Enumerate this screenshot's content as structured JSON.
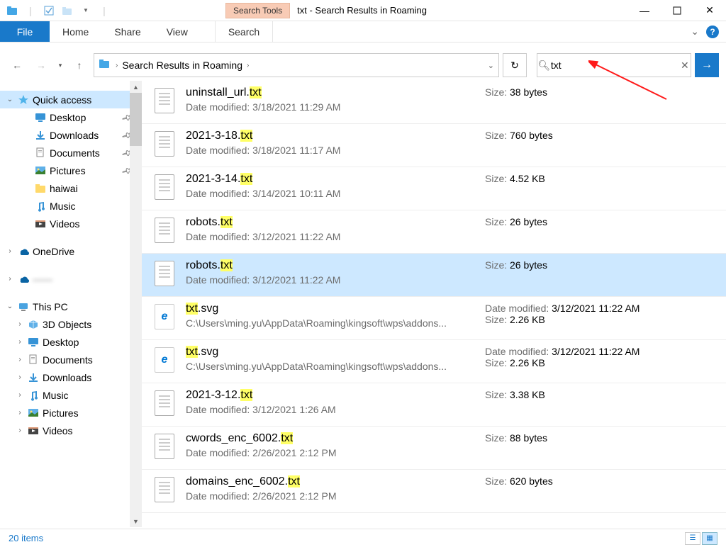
{
  "titlebar": {
    "search_tools": "Search Tools",
    "title": "txt - Search Results in Roaming"
  },
  "ribbon": {
    "file": "File",
    "tabs": [
      "Home",
      "Share",
      "View",
      "Search"
    ]
  },
  "breadcrumb": {
    "text": "Search Results in Roaming"
  },
  "search": {
    "value": "txt"
  },
  "sidebar": {
    "quick_access": "Quick access",
    "qa_items": [
      {
        "label": "Desktop",
        "pinned": true,
        "icon": "desktop"
      },
      {
        "label": "Downloads",
        "pinned": true,
        "icon": "downloads"
      },
      {
        "label": "Documents",
        "pinned": true,
        "icon": "documents"
      },
      {
        "label": "Pictures",
        "pinned": true,
        "icon": "pictures"
      },
      {
        "label": "haiwai",
        "pinned": false,
        "icon": "folder"
      },
      {
        "label": "Music",
        "pinned": false,
        "icon": "music"
      },
      {
        "label": "Videos",
        "pinned": false,
        "icon": "videos"
      }
    ],
    "onedrive": "OneDrive",
    "cloud2": "——",
    "this_pc": "This PC",
    "pc_items": [
      {
        "label": "3D Objects",
        "icon": "3d"
      },
      {
        "label": "Desktop",
        "icon": "desktop"
      },
      {
        "label": "Documents",
        "icon": "documents"
      },
      {
        "label": "Downloads",
        "icon": "downloads"
      },
      {
        "label": "Music",
        "icon": "music"
      },
      {
        "label": "Pictures",
        "icon": "pictures"
      },
      {
        "label": "Videos",
        "icon": "videos"
      }
    ]
  },
  "labels": {
    "size": "Size:",
    "date_modified": "Date modified:"
  },
  "items": [
    {
      "name_pre": "uninstall_url.",
      "hl": "txt",
      "name_post": "",
      "line2_kind": "date",
      "line2": "3/18/2021 11:29 AM",
      "r1_kind": "size",
      "r1": "38 bytes",
      "r2_kind": "",
      "r2": "",
      "icon": "doc",
      "sel": false
    },
    {
      "name_pre": "2021-3-18.",
      "hl": "txt",
      "name_post": "",
      "line2_kind": "date",
      "line2": "3/18/2021 11:17 AM",
      "r1_kind": "size",
      "r1": "760 bytes",
      "r2_kind": "",
      "r2": "",
      "icon": "doc",
      "sel": false
    },
    {
      "name_pre": "2021-3-14.",
      "hl": "txt",
      "name_post": "",
      "line2_kind": "date",
      "line2": "3/14/2021 10:11 AM",
      "r1_kind": "size",
      "r1": "4.52 KB",
      "r2_kind": "",
      "r2": "",
      "icon": "doc",
      "sel": false
    },
    {
      "name_pre": "robots.",
      "hl": "txt",
      "name_post": "",
      "line2_kind": "date",
      "line2": "3/12/2021 11:22 AM",
      "r1_kind": "size",
      "r1": "26 bytes",
      "r2_kind": "",
      "r2": "",
      "icon": "doc",
      "sel": false
    },
    {
      "name_pre": "robots.",
      "hl": "txt",
      "name_post": "",
      "line2_kind": "date",
      "line2": "3/12/2021 11:22 AM",
      "r1_kind": "size",
      "r1": "26 bytes",
      "r2_kind": "",
      "r2": "",
      "icon": "doc",
      "sel": true
    },
    {
      "name_pre": "",
      "hl": "txt",
      "name_post": ".svg",
      "line2_kind": "path",
      "line2": "C:\\Users\\ming.yu\\AppData\\Roaming\\kingsoft\\wps\\addons...",
      "r1_kind": "date",
      "r1": "3/12/2021 11:22 AM",
      "r2_kind": "size",
      "r2": "2.26 KB",
      "icon": "edge",
      "sel": false
    },
    {
      "name_pre": "",
      "hl": "txt",
      "name_post": ".svg",
      "line2_kind": "path",
      "line2": "C:\\Users\\ming.yu\\AppData\\Roaming\\kingsoft\\wps\\addons...",
      "r1_kind": "date",
      "r1": "3/12/2021 11:22 AM",
      "r2_kind": "size",
      "r2": "2.26 KB",
      "icon": "edge",
      "sel": false
    },
    {
      "name_pre": "2021-3-12.",
      "hl": "txt",
      "name_post": "",
      "line2_kind": "date",
      "line2": "3/12/2021 1:26 AM",
      "r1_kind": "size",
      "r1": "3.38 KB",
      "r2_kind": "",
      "r2": "",
      "icon": "doc",
      "sel": false
    },
    {
      "name_pre": "cwords_enc_6002.",
      "hl": "txt",
      "name_post": "",
      "line2_kind": "date",
      "line2": "2/26/2021 2:12 PM",
      "r1_kind": "size",
      "r1": "88 bytes",
      "r2_kind": "",
      "r2": "",
      "icon": "doc",
      "sel": false
    },
    {
      "name_pre": "domains_enc_6002.",
      "hl": "txt",
      "name_post": "",
      "line2_kind": "date",
      "line2": "2/26/2021 2:12 PM",
      "r1_kind": "size",
      "r1": "620 bytes",
      "r2_kind": "",
      "r2": "",
      "icon": "doc",
      "sel": false
    }
  ],
  "status": {
    "text": "20 items"
  }
}
